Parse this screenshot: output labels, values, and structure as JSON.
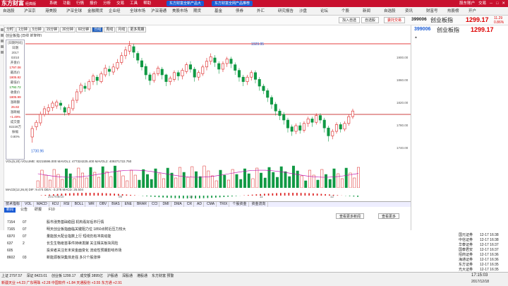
{
  "app": {
    "name": "东方财富",
    "edition": "经典版"
  },
  "top_menu": [
    "系统",
    "功能",
    "行情",
    "报价",
    "分析",
    "交易",
    "工具",
    "帮助"
  ],
  "promos": [
    "东方财富全新产品大",
    "东方财富全网产品推荐"
  ],
  "top_right": [
    "股东账户",
    "交易",
    "1.0"
  ],
  "nav_items": [
    "自选股",
    "沪深京",
    "港美股",
    "沪深全球",
    "金融期货",
    "企业经",
    "全球市场",
    "沪深港通",
    "美股市场",
    "期货",
    "基金",
    "债券",
    "外汇",
    "研究报告",
    "沙盘",
    "论坛",
    "个股",
    "新闻",
    "自选股",
    "资讯",
    "财富号",
    "热股榜",
    "开户"
  ],
  "toolbar": {
    "buttons": [
      "加入自选",
      "自选股",
      "委托交易"
    ],
    "code": "399006",
    "name": "创业板指",
    "price": "1299.17",
    "change": "11.29",
    "change_pct": "0.86%"
  },
  "period_tabs": [
    "分时",
    "1分钟",
    "5分钟",
    "15分钟",
    "30分钟",
    "60分钟",
    "日线",
    "周线",
    "月线",
    "更多周期"
  ],
  "chart_header": "创业板指 (日线 前复权)",
  "info_box": [
    {
      "label": "[日期时间]",
      "cls": ""
    },
    {
      "label": "日期",
      "cls": ""
    },
    {
      "label": "2017",
      "cls": ""
    },
    {
      "label": "03/10",
      "cls": ""
    },
    {
      "label": "开盘价",
      "cls": ""
    },
    {
      "label": "1797.08",
      "cls": "r"
    },
    {
      "label": "最高价",
      "cls": ""
    },
    {
      "label": "1805.82",
      "cls": "r"
    },
    {
      "label": "最低价",
      "cls": ""
    },
    {
      "label": "1792.72",
      "cls": "g"
    },
    {
      "label": "收盘价",
      "cls": ""
    },
    {
      "label": "1805.99",
      "cls": "r"
    },
    {
      "label": "涨跌额",
      "cls": ""
    },
    {
      "label": "26.82",
      "cls": "r"
    },
    {
      "label": "涨跌幅",
      "cls": ""
    },
    {
      "label": "+1.49%",
      "cls": "r"
    },
    {
      "label": "成交量",
      "cls": ""
    },
    {
      "label": "82228万",
      "cls": ""
    },
    {
      "label": "振幅",
      "cls": ""
    },
    {
      "label": "0.80%",
      "cls": ""
    }
  ],
  "price_axis": [
    "1900.00",
    "1860.00",
    "1820.00",
    "1780.00",
    "1740.00"
  ],
  "max_label": "1929.95",
  "min_label": "1730.96",
  "volume_header": "VOL(5,20)  VOLUME: 82215596.000  MAVOL1: 477324225.400  MAVOL2: 409371722.750",
  "macd_header": "MACD(12,26,9)  DIF: 9.474  DEA: -3.378  MACD: 25.504",
  "date_labels": [
    "2017/08/10",
    "09",
    "10",
    "11",
    "12"
  ],
  "indicator_tabs": [
    "技术指标",
    "VOL",
    "MACD",
    "KDJ",
    "RSI",
    "BOLL",
    "WR",
    "OBV",
    "BIAS",
    "ENE",
    "BRAR",
    "CCI",
    "DMI",
    "DMA",
    "CR",
    "AD",
    "CMA",
    "TRIX",
    "个股资金",
    "资金流向"
  ],
  "news_tabs": [
    "新闻",
    "公告",
    "研报",
    "F10"
  ],
  "news": [
    {
      "id": "7154",
      "type": "07",
      "text": "股市涨势基础稳固 机构看好后市行情"
    },
    {
      "id": "7165",
      "type": "07",
      "text": "明天创业板指面临关键阻力位 1850点附近压力较大"
    },
    {
      "id": "6970",
      "type": "07",
      "text": "量能放大配合指数上行 短线仍有冲高动能"
    },
    {
      "id": "637",
      "type": "2",
      "text": "长生生物疫苗事件持续发酵 关注相关板块风险"
    },
    {
      "id": "605",
      "type": "",
      "text": "投资者关注年末资金面变化 流动性预期影响市场"
    },
    {
      "id": "8602",
      "type": "03",
      "text": "新能源板块集体走强 多只个股涨停"
    }
  ],
  "news_right_btn": [
    "查看更多新闻",
    "查看更多"
  ],
  "right_tabs": [
    "资讯",
    "公告",
    "研报"
  ],
  "right_quotes": [
    {
      "name": "国元证券",
      "time": "12-17 16:38"
    },
    {
      "name": "中信证券",
      "time": "12-17 16:38"
    },
    {
      "name": "华泰证券",
      "time": "12-17 16:37"
    },
    {
      "name": "国泰君安",
      "time": "12-17 16:37"
    },
    {
      "name": "招商证券",
      "time": "12-17 16:36"
    },
    {
      "name": "海通证券",
      "time": "12-17 16:36"
    },
    {
      "name": "东方证券",
      "time": "12-17 16:35"
    },
    {
      "name": "光大证券",
      "time": "12-17 16:35"
    }
  ],
  "status_items": [
    "上证 2797.57",
    "深证 8423.01",
    "创业板 1299.17",
    "成交额 3895亿",
    "沪股通",
    "深股通",
    "港股通",
    "东方财富 预警"
  ],
  "status_ticker": "新疆天业 +4.23  广东明珠 +2.28  中国软件 +1.84  天通股份 +3.55  东方通 +2.91",
  "clock": "17:15:03",
  "date": "2017/12/18",
  "chart_data": {
    "type": "candlestick",
    "ylim": [
      1730,
      1930
    ],
    "candles": [
      [
        1760,
        1775,
        1750,
        1780
      ],
      [
        1778,
        1786,
        1772,
        1790
      ],
      [
        1785,
        1800,
        1780,
        1805
      ],
      [
        1800,
        1810,
        1796,
        1815
      ],
      [
        1806,
        1812,
        1800,
        1818
      ],
      [
        1812,
        1820,
        1806,
        1824
      ],
      [
        1815,
        1822,
        1810,
        1826
      ],
      [
        1820,
        1816,
        1808,
        1825
      ],
      [
        1812,
        1804,
        1798,
        1815
      ],
      [
        1802,
        1812,
        1798,
        1818
      ],
      [
        1810,
        1825,
        1806,
        1830
      ],
      [
        1825,
        1840,
        1820,
        1845
      ],
      [
        1840,
        1852,
        1836,
        1856
      ],
      [
        1850,
        1846,
        1840,
        1856
      ],
      [
        1845,
        1858,
        1842,
        1862
      ],
      [
        1858,
        1868,
        1852,
        1872
      ],
      [
        1866,
        1860,
        1852,
        1870
      ],
      [
        1858,
        1872,
        1855,
        1876
      ],
      [
        1870,
        1882,
        1866,
        1888
      ],
      [
        1880,
        1876,
        1868,
        1886
      ],
      [
        1875,
        1884,
        1870,
        1890
      ],
      [
        1882,
        1892,
        1878,
        1898
      ],
      [
        1892,
        1904,
        1888,
        1910
      ],
      [
        1904,
        1914,
        1898,
        1920
      ],
      [
        1912,
        1922,
        1906,
        1930
      ],
      [
        1920,
        1910,
        1900,
        1925
      ],
      [
        1908,
        1896,
        1890,
        1912
      ],
      [
        1895,
        1884,
        1878,
        1900
      ],
      [
        1885,
        1870,
        1862,
        1890
      ],
      [
        1870,
        1860,
        1852,
        1874
      ],
      [
        1860,
        1872,
        1856,
        1876
      ],
      [
        1872,
        1882,
        1868,
        1886
      ],
      [
        1880,
        1870,
        1862,
        1884
      ],
      [
        1870,
        1858,
        1850,
        1872
      ],
      [
        1858,
        1864,
        1852,
        1868
      ],
      [
        1862,
        1874,
        1858,
        1878
      ],
      [
        1874,
        1868,
        1860,
        1878
      ],
      [
        1868,
        1878,
        1862,
        1882
      ],
      [
        1876,
        1888,
        1872,
        1892
      ],
      [
        1888,
        1880,
        1874,
        1894
      ],
      [
        1880,
        1866,
        1858,
        1884
      ],
      [
        1866,
        1874,
        1860,
        1878
      ],
      [
        1872,
        1884,
        1868,
        1888
      ],
      [
        1884,
        1894,
        1878,
        1900
      ],
      [
        1894,
        1902,
        1888,
        1908
      ],
      [
        1900,
        1892,
        1884,
        1905
      ],
      [
        1890,
        1880,
        1872,
        1894
      ],
      [
        1880,
        1890,
        1875,
        1894
      ],
      [
        1890,
        1898,
        1884,
        1902
      ],
      [
        1898,
        1890,
        1882,
        1902
      ],
      [
        1888,
        1878,
        1870,
        1892
      ],
      [
        1878,
        1866,
        1858,
        1882
      ],
      [
        1866,
        1858,
        1850,
        1870
      ],
      [
        1858,
        1866,
        1852,
        1870
      ],
      [
        1866,
        1874,
        1860,
        1878
      ],
      [
        1874,
        1862,
        1855,
        1878
      ],
      [
        1862,
        1850,
        1842,
        1866
      ],
      [
        1850,
        1842,
        1836,
        1854
      ],
      [
        1842,
        1830,
        1822,
        1846
      ],
      [
        1830,
        1818,
        1810,
        1834
      ],
      [
        1818,
        1806,
        1798,
        1822
      ],
      [
        1806,
        1798,
        1790,
        1810
      ],
      [
        1800,
        1790,
        1782,
        1804
      ],
      [
        1790,
        1776,
        1768,
        1794
      ],
      [
        1778,
        1770,
        1762,
        1782
      ],
      [
        1770,
        1780,
        1765,
        1784
      ],
      [
        1780,
        1772,
        1766,
        1786
      ],
      [
        1772,
        1784,
        1768,
        1788
      ],
      [
        1784,
        1792,
        1778,
        1796
      ],
      [
        1792,
        1786,
        1778,
        1796
      ],
      [
        1786,
        1798,
        1782,
        1802
      ],
      [
        1798,
        1790,
        1784,
        1802
      ],
      [
        1790,
        1776,
        1768,
        1794
      ],
      [
        1776,
        1762,
        1752,
        1780
      ],
      [
        1762,
        1770,
        1756,
        1774
      ],
      [
        1770,
        1782,
        1766,
        1786
      ],
      [
        1782,
        1774,
        1768,
        1786
      ],
      [
        1774,
        1784,
        1770,
        1788
      ],
      [
        1784,
        1796,
        1780,
        1800
      ],
      [
        1796,
        1806,
        1792,
        1810
      ]
    ]
  }
}
